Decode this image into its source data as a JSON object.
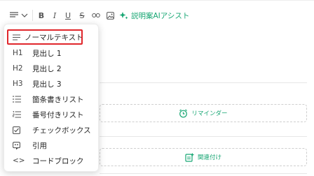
{
  "toolbar": {
    "buttons": [
      "text-style",
      "bold",
      "italic",
      "underline",
      "strikethrough",
      "link",
      "image"
    ],
    "bold_label": "B",
    "italic_label": "I",
    "underline_label": "U",
    "strike_label": "S",
    "ai_label": "説明案AIアシスト",
    "accent_color": "#17a673"
  },
  "menu": {
    "items": [
      {
        "icon_text": "",
        "icon": "paragraph-icon",
        "label": "ノーマルテキスト",
        "selected": true
      },
      {
        "icon_text": "H1",
        "icon": "heading1-icon",
        "label": "見出し 1"
      },
      {
        "icon_text": "H2",
        "icon": "heading2-icon",
        "label": "見出し 2"
      },
      {
        "icon_text": "H3",
        "icon": "heading3-icon",
        "label": "見出し 3"
      },
      {
        "icon_text": "",
        "icon": "bullet-list-icon",
        "label": "箇条書きリスト"
      },
      {
        "icon_text": "",
        "icon": "numbered-list-icon",
        "label": "番号付きリスト"
      },
      {
        "icon_text": "",
        "icon": "checkbox-icon",
        "label": "チェックボックス"
      },
      {
        "icon_text": "",
        "icon": "quote-icon",
        "label": "引用"
      },
      {
        "icon_text": "<>",
        "icon": "code-icon",
        "label": "コードブロック"
      }
    ],
    "highlight_color": "#e0262b"
  },
  "content": {
    "reminder_label": "リマインダー",
    "related_label": "関連付け"
  }
}
